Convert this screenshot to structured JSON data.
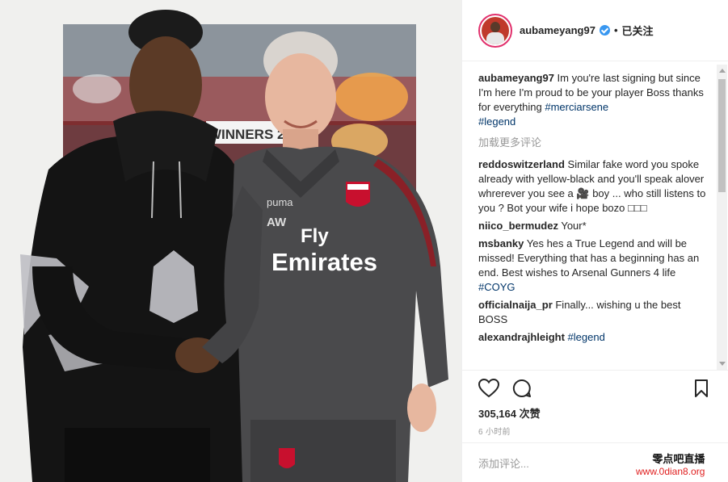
{
  "post": {
    "username": "aubameyang97",
    "follow_status": "已关注",
    "separator": "•",
    "photo_sign": "WINNERS 201",
    "shirt_sponsor_1": "Fly",
    "shirt_sponsor_2": "Emirates",
    "initials": "AW",
    "likes": "305,164 次赞",
    "time": "6 小时前",
    "add_comment_placeholder": "添加评论..."
  },
  "comments": {
    "caption": {
      "user": "aubameyang97",
      "text": " Im you're last signing but since I'm here I'm proud to be your player Boss thanks for everything ",
      "tag1": "#merciarsene",
      "tag2": "#legend"
    },
    "load_more": "加载更多评论",
    "items": [
      {
        "user": "reddoswitzerland",
        "text": " Similar fake word you spoke already with yellow-black and you'll speak alover whrerever you see a 🎥 boy ... who still listens to you ? Bot your wife i hope bozo □□□"
      },
      {
        "user": "niico_bermudez",
        "text": " Your*"
      },
      {
        "user": "msbanky",
        "text": " Yes hes a True Legend and will be missed! Everything that has a beginning has an end. Best wishes to Arsenal Gunners 4 life ",
        "tag": "#COYG"
      },
      {
        "user": "officialnaija_pr",
        "text": " Finally... wishing u the best BOSS"
      },
      {
        "user": "alexandrajhleight",
        "text": " ",
        "tag": "#legend"
      }
    ]
  },
  "watermark": {
    "cn": "零点吧直播",
    "url": "www.0dian8.org"
  },
  "colors": {
    "verified": "#3897f0",
    "tag": "#003569",
    "jacket": "#4a4a4c",
    "hoodie": "#141414",
    "arsenal_red": "#c8102e"
  }
}
